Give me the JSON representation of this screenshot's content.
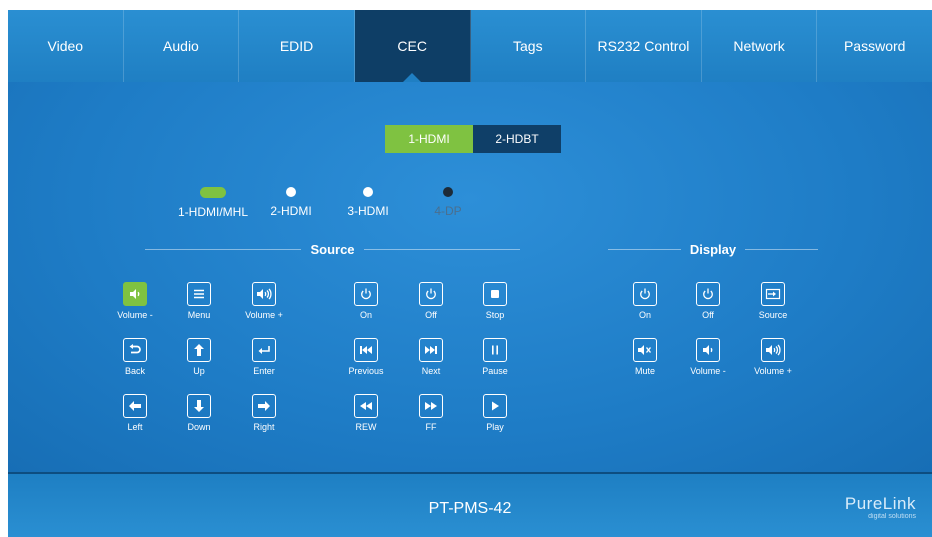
{
  "nav": {
    "tabs": [
      {
        "label": "Video",
        "active": false
      },
      {
        "label": "Audio",
        "active": false
      },
      {
        "label": "EDID",
        "active": false
      },
      {
        "label": "CEC",
        "active": true
      },
      {
        "label": "Tags",
        "active": false
      },
      {
        "label": "RS232 Control",
        "active": false
      },
      {
        "label": "Network",
        "active": false
      },
      {
        "label": "Password",
        "active": false
      }
    ]
  },
  "outputs": [
    {
      "label": "1-HDMI",
      "selected": true
    },
    {
      "label": "2-HDBT",
      "selected": false
    }
  ],
  "inputs": [
    {
      "label": "1-HDMI/MHL",
      "state": "active"
    },
    {
      "label": "2-HDMI",
      "state": "normal"
    },
    {
      "label": "3-HDMI",
      "state": "normal"
    },
    {
      "label": "4-DP",
      "state": "disabled"
    }
  ],
  "source": {
    "title": "Source",
    "buttons": [
      {
        "label": "Volume -",
        "icon": "volume-down-icon",
        "active": true
      },
      {
        "label": "Menu",
        "icon": "menu-icon"
      },
      {
        "label": "Volume +",
        "icon": "volume-up-icon"
      },
      {
        "label": "On",
        "icon": "power-icon"
      },
      {
        "label": "Off",
        "icon": "power-icon"
      },
      {
        "label": "Stop",
        "icon": "stop-icon"
      },
      {
        "label": "Back",
        "icon": "back-icon"
      },
      {
        "label": "Up",
        "icon": "arrow-up-icon"
      },
      {
        "label": "Enter",
        "icon": "enter-icon"
      },
      {
        "label": "Previous",
        "icon": "previous-icon"
      },
      {
        "label": "Next",
        "icon": "next-icon"
      },
      {
        "label": "Pause",
        "icon": "pause-icon"
      },
      {
        "label": "Left",
        "icon": "arrow-left-icon"
      },
      {
        "label": "Down",
        "icon": "arrow-down-icon"
      },
      {
        "label": "Right",
        "icon": "arrow-right-icon"
      },
      {
        "label": "REW",
        "icon": "rewind-icon"
      },
      {
        "label": "FF",
        "icon": "fast-forward-icon"
      },
      {
        "label": "Play",
        "icon": "play-icon"
      }
    ]
  },
  "display": {
    "title": "Display",
    "buttons": [
      {
        "label": "On",
        "icon": "power-icon"
      },
      {
        "label": "Off",
        "icon": "power-icon"
      },
      {
        "label": "Source",
        "icon": "source-icon"
      },
      {
        "label": "Mute",
        "icon": "mute-icon"
      },
      {
        "label": "Volume -",
        "icon": "volume-down-icon"
      },
      {
        "label": "Volume +",
        "icon": "volume-up-icon"
      }
    ]
  },
  "footer": {
    "model": "PT-PMS-42",
    "brand": "PureLink",
    "tagline": "digital solutions"
  },
  "colors": {
    "accent_green": "#7fc241",
    "nav_active": "#0e3e66",
    "panel_blue": "#1e7cc6"
  }
}
